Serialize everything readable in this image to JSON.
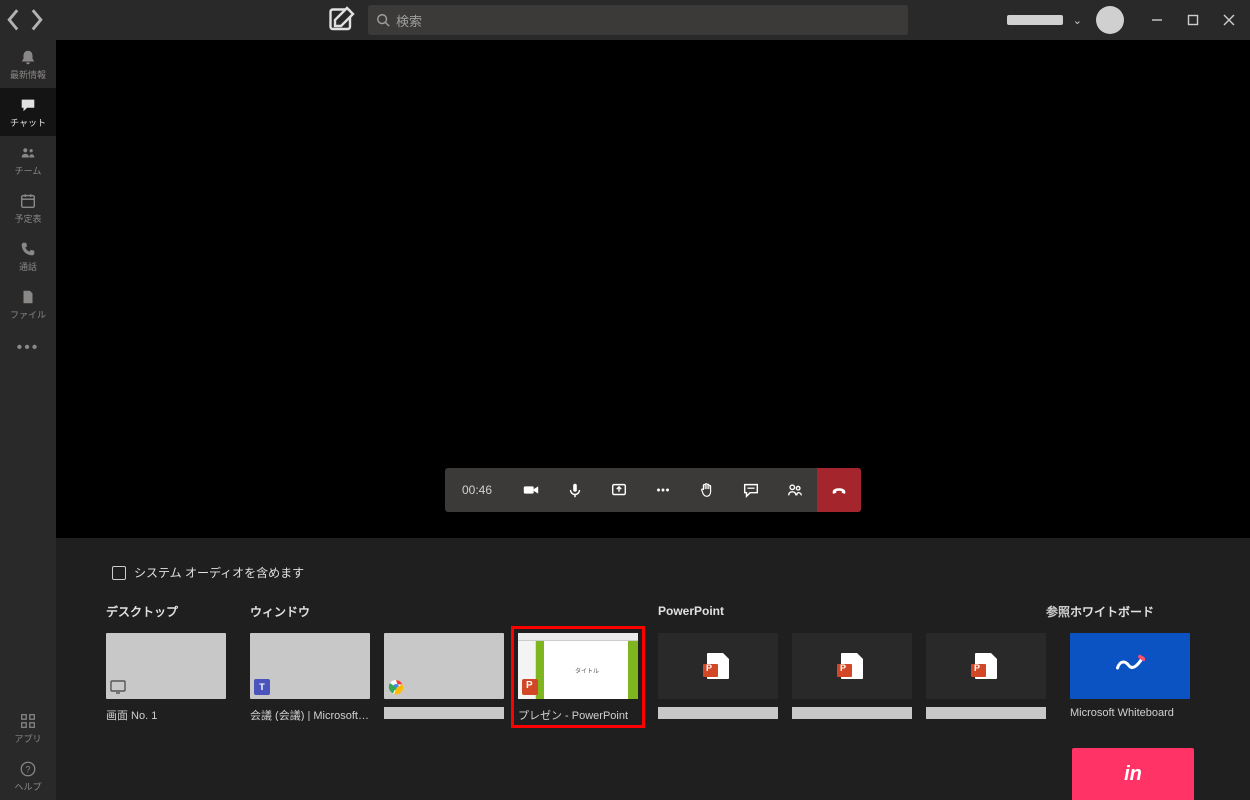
{
  "titlebar": {
    "search_placeholder": "検索"
  },
  "sidebar": {
    "items": [
      {
        "label": "最新情報",
        "icon": "bell"
      },
      {
        "label": "チャット",
        "icon": "chat",
        "active": true
      },
      {
        "label": "チーム",
        "icon": "teams"
      },
      {
        "label": "予定表",
        "icon": "calendar"
      },
      {
        "label": "通話",
        "icon": "calls"
      },
      {
        "label": "ファイル",
        "icon": "files"
      }
    ],
    "bottom": [
      {
        "label": "アプリ",
        "icon": "apps"
      },
      {
        "label": "ヘルプ",
        "icon": "help"
      }
    ]
  },
  "toolbar": {
    "timer": "00:46"
  },
  "tray": {
    "audio_label": "システム オーディオを含めます",
    "desktop_header": "デスクトップ",
    "window_header": "ウィンドウ",
    "powerpoint_header": "PowerPoint",
    "browse_label": "参照",
    "whiteboard_header": "ホワイトボード",
    "desktop_items": [
      {
        "label": "画面 No. 1"
      }
    ],
    "window_items": [
      {
        "label": "会議 (会議) | Microsoft Te...",
        "app": "teams"
      },
      {
        "label": "",
        "app": "chrome",
        "redacted": true
      },
      {
        "label": "プレゼン - PowerPoint",
        "app": "powerpoint",
        "selected": true,
        "slide_title": "タイトル"
      }
    ],
    "powerpoint_items": [
      {
        "redacted": true
      },
      {
        "redacted": true
      },
      {
        "redacted": true
      }
    ],
    "whiteboard_items": [
      {
        "label": "Microsoft Whiteboard"
      }
    ],
    "extra_card": "in"
  }
}
